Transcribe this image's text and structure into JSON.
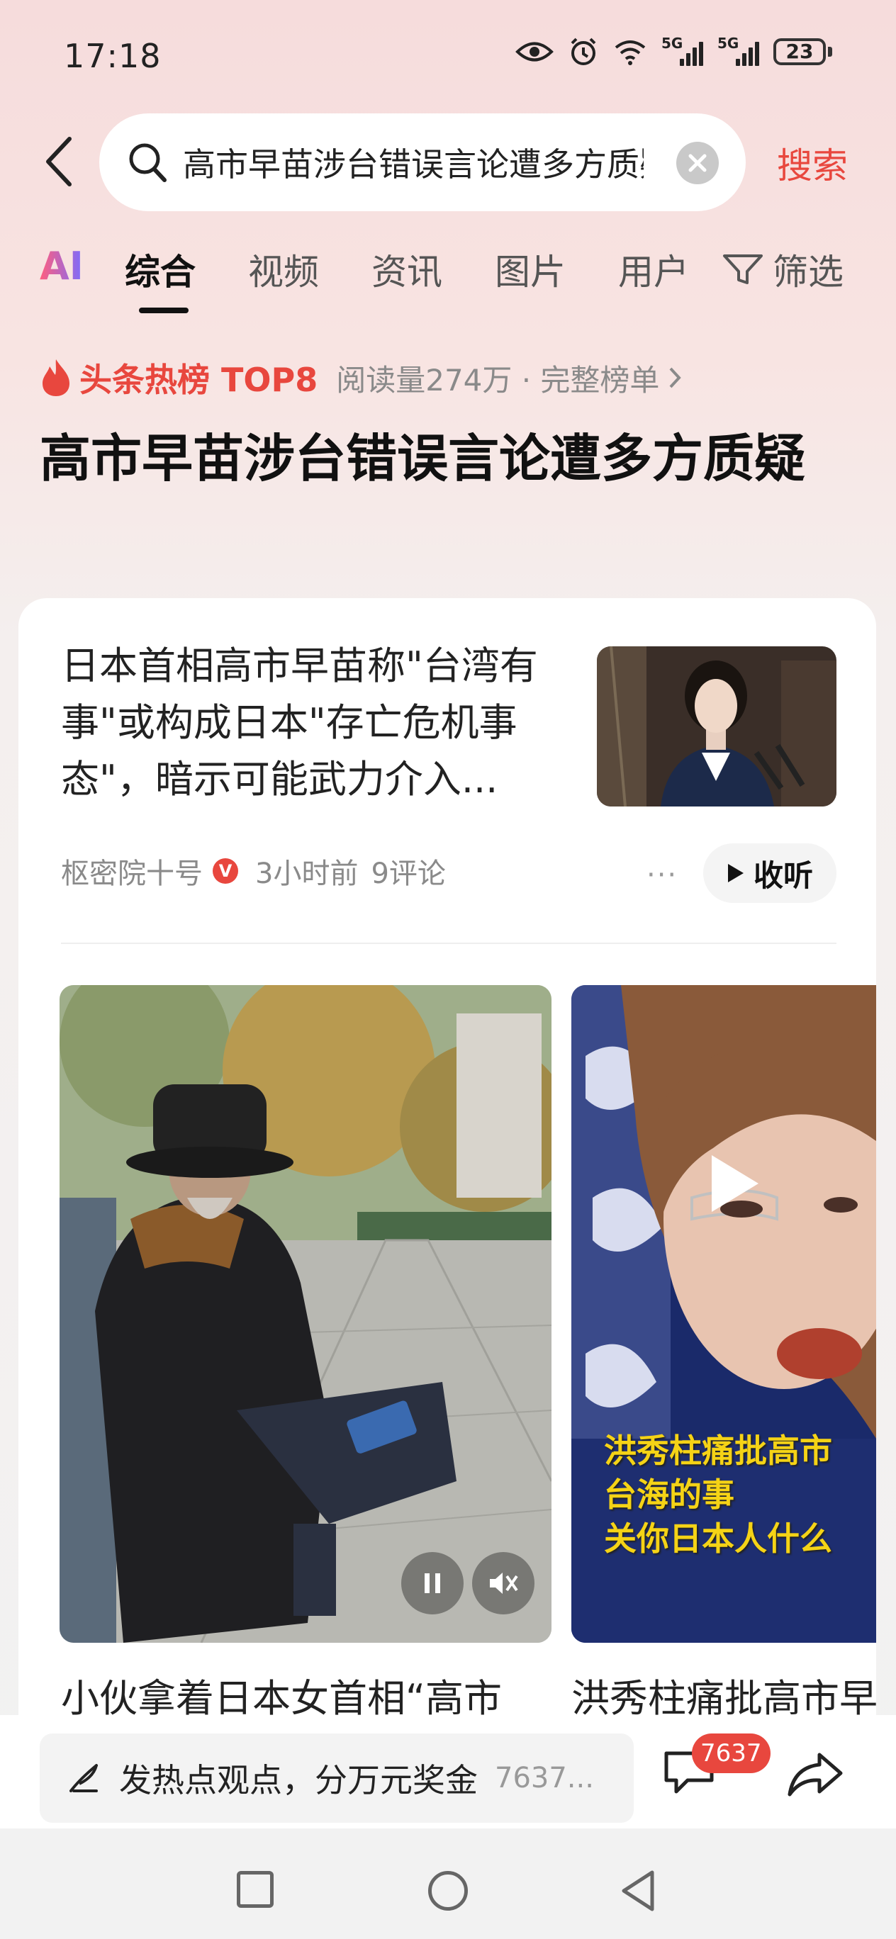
{
  "status_bar": {
    "time": "17:18",
    "battery": "23",
    "net1": "5G",
    "net2": "5G"
  },
  "search": {
    "query": "高市早苗涉台错误言论遭多方质疑",
    "button_label": "搜索"
  },
  "tabs": [
    {
      "label": "AI"
    },
    {
      "label": "综合"
    },
    {
      "label": "视频"
    },
    {
      "label": "资讯"
    },
    {
      "label": "图片"
    },
    {
      "label": "用户"
    }
  ],
  "filter_label": "筛选",
  "hot": {
    "badge": "头条热榜 TOP8",
    "meta": "阅读量274万 · 完整榜单",
    "topic_title": "高市早苗涉台错误言论遭多方质疑"
  },
  "article": {
    "title": "日本首相高市早苗称\"台湾有事\"或构成日本\"存亡危机事态\"，暗示可能武力介入...",
    "source": "枢密院十号",
    "verified": "V",
    "time": "3小时前",
    "comments": "9评论",
    "more": "···",
    "listen_label": "收听"
  },
  "videos": [
    {
      "title": "小伙拿着日本女首相“高市"
    },
    {
      "title": "洪秀柱痛批高市早",
      "caption_lines": [
        "洪秀柱痛批高市",
        "台海的事",
        "关你日本人什么"
      ]
    }
  ],
  "bottom": {
    "comment_placeholder": "发热点观点，分万元奖金",
    "comment_count_text": "7637...",
    "badge_count": "7637"
  },
  "colors": {
    "accent": "#e8473e",
    "background_top": "#f6dcdc"
  },
  "icons": [
    "back-icon",
    "search-icon",
    "clear-icon",
    "filter-icon",
    "fire-icon",
    "chevron-right-icon",
    "play-icon",
    "pause-icon",
    "mute-icon",
    "pen-icon",
    "comment-icon",
    "share-icon"
  ]
}
